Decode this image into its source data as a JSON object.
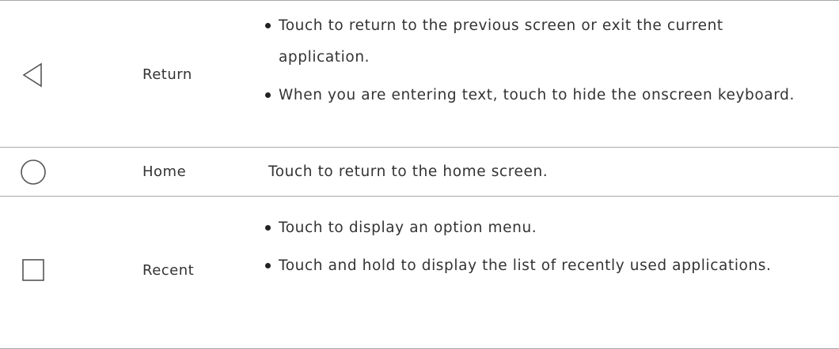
{
  "rows": [
    {
      "icon": "back-triangle-icon",
      "name": "Return",
      "bullets": [
        "Touch to return to the previous screen or exit the current application.",
        "When you are entering text, touch to hide the onscreen keyboard."
      ]
    },
    {
      "icon": "home-circle-icon",
      "name": "Home",
      "text": "Touch to return to the home screen."
    },
    {
      "icon": "recent-square-icon",
      "name": "Recent",
      "bullets": [
        "Touch to display an option menu.",
        "Touch and hold to display the list of recently used applications."
      ]
    }
  ],
  "colors": {
    "text": "#333333",
    "border": "#a8a8a8",
    "icon_stroke": "#555555"
  }
}
